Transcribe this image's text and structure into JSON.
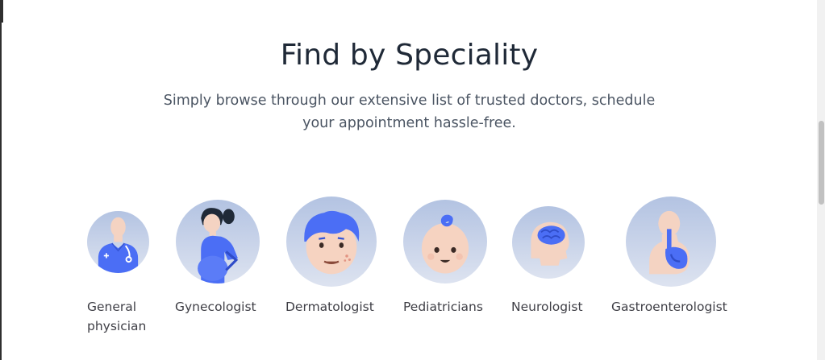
{
  "section": {
    "title": "Find by Speciality",
    "subtitle_line1": "Simply browse through our extensive list of trusted doctors, schedule",
    "subtitle_line2": "your appointment hassle-free."
  },
  "specialities": [
    {
      "label_line1": "General",
      "label_line2": "physician",
      "icon": "doctor-stethoscope-icon"
    },
    {
      "label_line1": "Gynecologist",
      "icon": "pregnant-woman-icon"
    },
    {
      "label_line1": "Dermatologist",
      "icon": "face-skin-icon"
    },
    {
      "label_line1": "Pediatricians",
      "icon": "baby-face-icon"
    },
    {
      "label_line1": "Neurologist",
      "icon": "brain-icon"
    },
    {
      "label_line1": "Gastroenterologist",
      "icon": "stomach-icon"
    }
  ],
  "colors": {
    "title": "#1f2937",
    "subtitle": "#4b5563",
    "circle_top": "#b3c3e2",
    "circle_bottom": "#dde3f0",
    "accent_blue": "#4b6ef5"
  }
}
